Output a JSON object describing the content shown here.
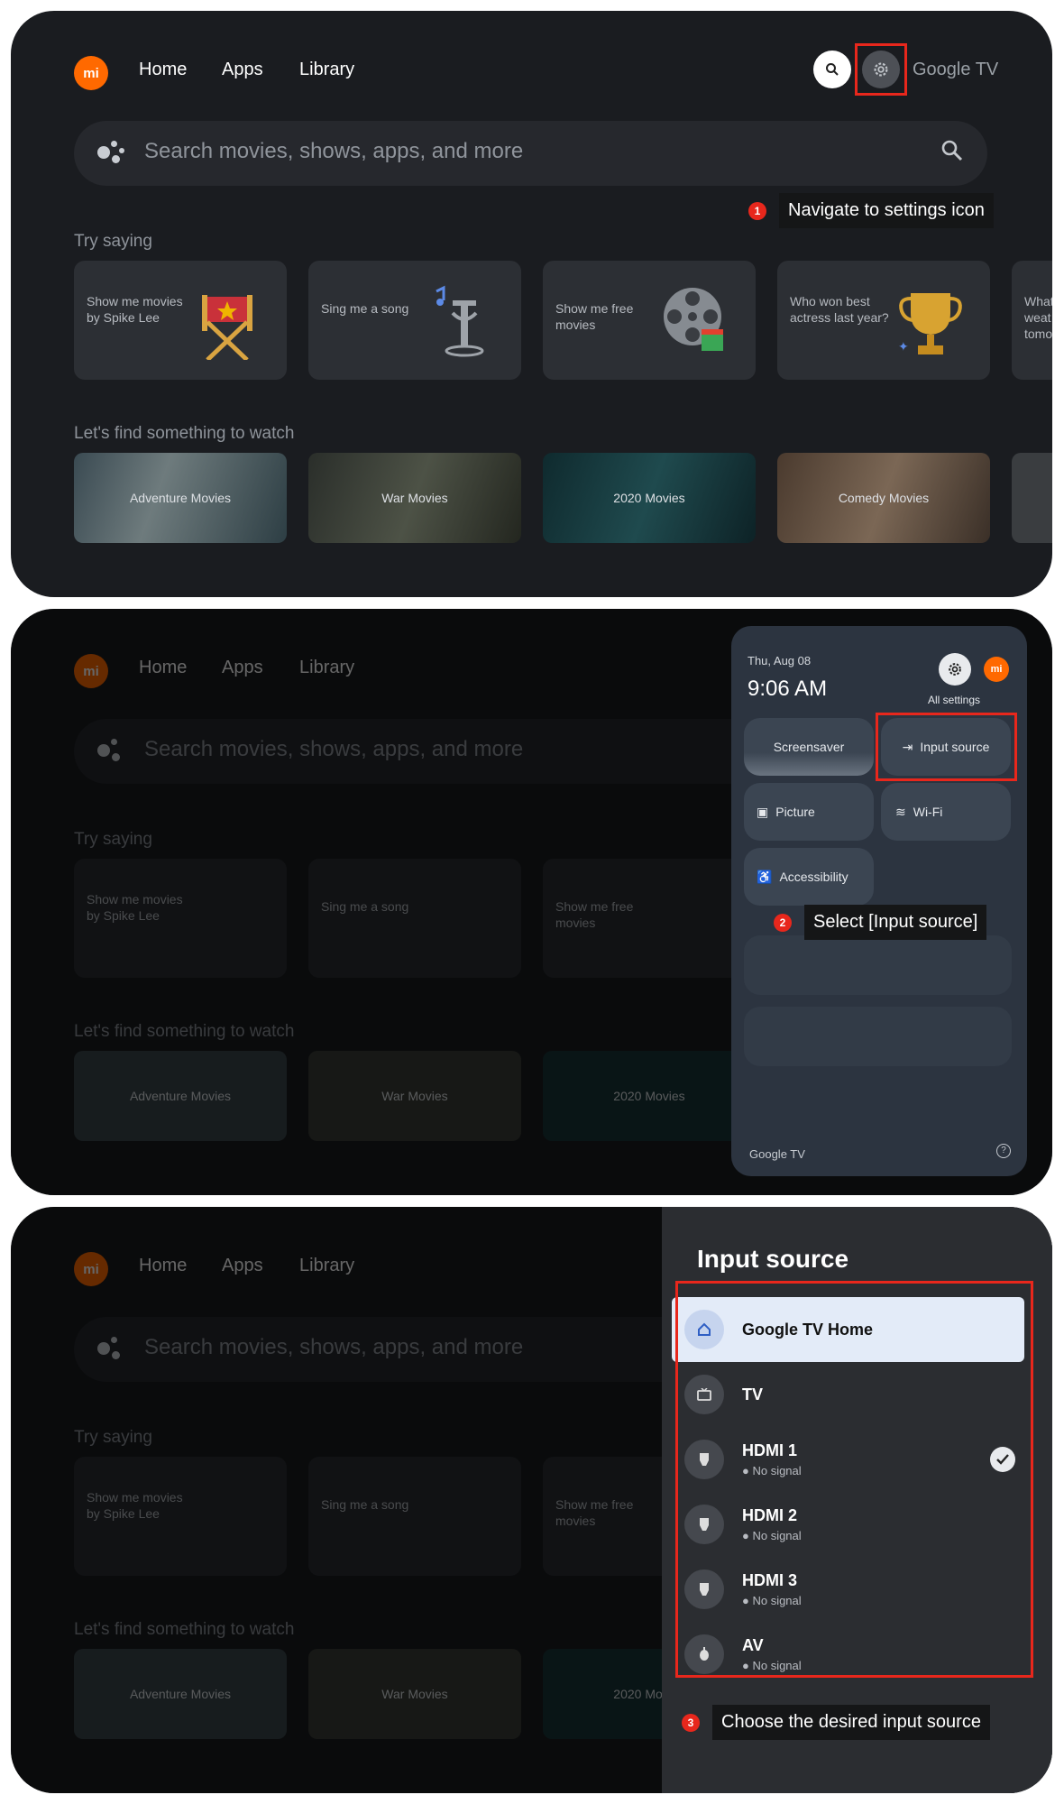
{
  "home": {
    "logo": "mi",
    "nav": [
      "Home",
      "Apps",
      "Library"
    ],
    "brand": "Google TV",
    "search_placeholder": "Search movies, shows, apps, and more",
    "try_saying_title": "Try saying",
    "cards": [
      {
        "text": "Show me movies by Spike Lee",
        "icon": "director-chair-icon"
      },
      {
        "text": "Sing me a song",
        "icon": "microphone-icon"
      },
      {
        "text": "Show me free movies",
        "icon": "film-reel-icon"
      },
      {
        "text": "Who won best actress last year?",
        "icon": "trophy-icon"
      },
      {
        "text": "What weat tomo",
        "icon": ""
      }
    ],
    "find_title": "Let's find something to watch",
    "movies": [
      "Adventure Movies",
      "War Movies",
      "2020 Movies",
      "Comedy Movies",
      ""
    ]
  },
  "quick_settings": {
    "date": "Thu, Aug 08",
    "time": "9:06 AM",
    "all_settings": "All settings",
    "tiles": [
      "Screensaver",
      "Input source",
      "Picture",
      "Wi-Fi",
      "Accessibility"
    ],
    "footer": "Google TV"
  },
  "input_source": {
    "title": "Input source",
    "items": [
      {
        "name": "Google TV Home",
        "sub": "",
        "icon": "home-icon"
      },
      {
        "name": "TV",
        "sub": "",
        "icon": "tv-icon"
      },
      {
        "name": "HDMI 1",
        "sub": "● No signal",
        "icon": "hdmi-icon"
      },
      {
        "name": "HDMI 2",
        "sub": "● No signal",
        "icon": "hdmi-icon"
      },
      {
        "name": "HDMI 3",
        "sub": "● No signal",
        "icon": "hdmi-icon"
      },
      {
        "name": "AV",
        "sub": "● No signal",
        "icon": "av-icon"
      }
    ]
  },
  "steps": [
    {
      "num": "1",
      "text": "Navigate to settings icon"
    },
    {
      "num": "2",
      "text": "Select [Input source]"
    },
    {
      "num": "3",
      "text": "Choose the desired input source"
    }
  ],
  "colors": {
    "accent": "#e8271c",
    "brand": "#ff6900",
    "selected": "#e3ebf8"
  }
}
